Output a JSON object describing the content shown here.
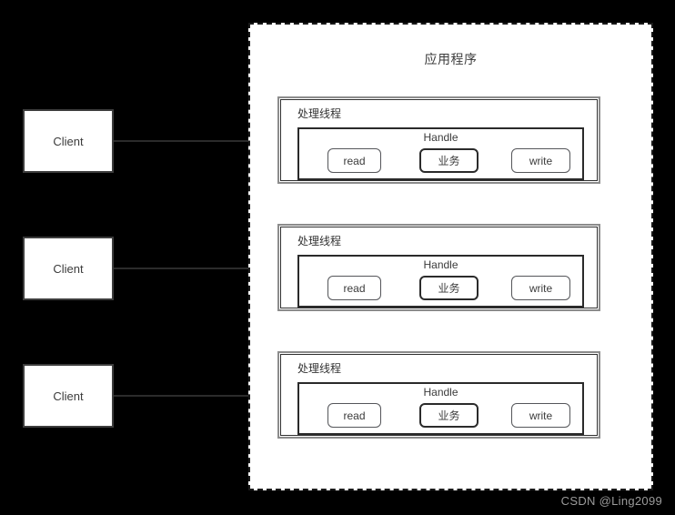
{
  "diagram": {
    "background_color": "#000000",
    "canvas_color": "#ffffff",
    "title": "应用程序",
    "watermark": "CSDN @Ling2099",
    "clients": [
      {
        "label": "Client"
      },
      {
        "label": "Client"
      },
      {
        "label": "Client"
      }
    ],
    "arrows": [
      {
        "name": "client-1-to-thread-1"
      },
      {
        "name": "client-2-to-thread-2"
      },
      {
        "name": "client-3-to-thread-3"
      }
    ],
    "threads": [
      {
        "label": "处理线程",
        "handle": {
          "label": "Handle",
          "ops": [
            {
              "label": "read"
            },
            {
              "label": "业务"
            },
            {
              "label": "write"
            }
          ]
        }
      },
      {
        "label": "处理线程",
        "handle": {
          "label": "Handle",
          "ops": [
            {
              "label": "read"
            },
            {
              "label": "业务"
            },
            {
              "label": "write"
            }
          ]
        }
      },
      {
        "label": "处理线程",
        "handle": {
          "label": "Handle",
          "ops": [
            {
              "label": "read"
            },
            {
              "label": "业务"
            },
            {
              "label": "write"
            }
          ]
        }
      }
    ]
  }
}
